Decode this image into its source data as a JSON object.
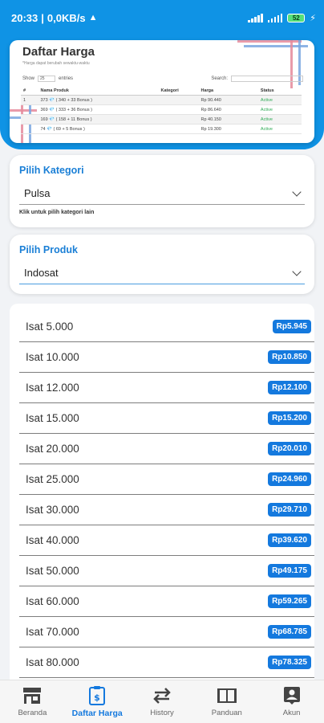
{
  "status_bar": {
    "time": "20:33",
    "network_speed": "0,0KB/s",
    "battery": "52"
  },
  "banner": {
    "title": "Daftar Harga",
    "subtitle": "*Harga dapat berubah sewaktu-waktu",
    "show_label": "Show",
    "show_value": "25",
    "entries_label": "entries",
    "search_label": "Search:",
    "columns": [
      "#",
      "Nama Produk",
      "Kategori",
      "Harga",
      "Status"
    ],
    "rows": [
      {
        "no": "1",
        "product": "373 💎 ( 340 + 33 Bonus )",
        "category": "",
        "price": "Rp 90.440",
        "status": "Active"
      },
      {
        "no": "",
        "product": "369 💎 ( 333 + 36 Bonus )",
        "category": "",
        "price": "Rp 86.640",
        "status": "Active"
      },
      {
        "no": "",
        "product": "169 💎 ( 158 + 11 Bonus )",
        "category": "",
        "price": "Rp 40.150",
        "status": "Active"
      },
      {
        "no": "",
        "product": "74 💎 ( 69 + 5 Bonus )",
        "category": "",
        "price": "Rp 19.300",
        "status": "Active"
      }
    ]
  },
  "kategori": {
    "label": "Pilih Kategori",
    "value": "Pulsa",
    "hint": "Klik untuk pilih kategori lain"
  },
  "produk": {
    "label": "Pilih Produk",
    "value": "Indosat"
  },
  "products": [
    {
      "name": "Isat 5.000",
      "price": "Rp5.945"
    },
    {
      "name": "Isat 10.000",
      "price": "Rp10.850"
    },
    {
      "name": "Isat 12.000",
      "price": "Rp12.100"
    },
    {
      "name": "Isat 15.000",
      "price": "Rp15.200"
    },
    {
      "name": "Isat 20.000",
      "price": "Rp20.010"
    },
    {
      "name": "Isat 25.000",
      "price": "Rp24.960"
    },
    {
      "name": "Isat 30.000",
      "price": "Rp29.710"
    },
    {
      "name": "Isat 40.000",
      "price": "Rp39.620"
    },
    {
      "name": "Isat 50.000",
      "price": "Rp49.175"
    },
    {
      "name": "Isat 60.000",
      "price": "Rp59.265"
    },
    {
      "name": "Isat 70.000",
      "price": "Rp68.785"
    },
    {
      "name": "Isat 80.000",
      "price": "Rp78.325"
    }
  ],
  "nav": [
    {
      "label": "Beranda",
      "icon": "store-icon",
      "active": false
    },
    {
      "label": "Daftar Harga",
      "icon": "price-list-icon",
      "active": true
    },
    {
      "label": "History",
      "icon": "swap-arrows-icon",
      "active": false
    },
    {
      "label": "Panduan",
      "icon": "book-icon",
      "active": false
    },
    {
      "label": "Akun",
      "icon": "account-icon",
      "active": false
    }
  ],
  "colors": {
    "primary": "#0f93e5",
    "accent": "#1479de",
    "price_badge": "#1479de",
    "active_status": "#2eaa55"
  }
}
